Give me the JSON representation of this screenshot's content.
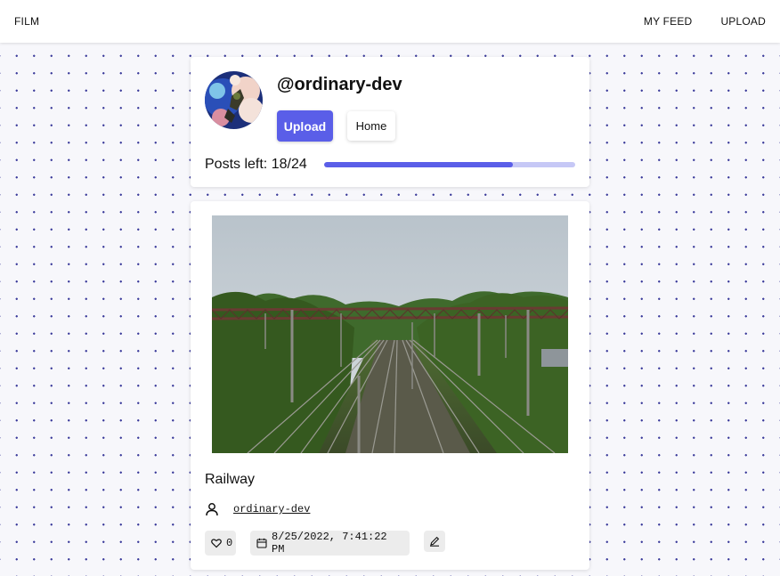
{
  "nav": {
    "brand": "FILM",
    "my_feed": "MY FEED",
    "upload": "UPLOAD"
  },
  "profile": {
    "username": "@ordinary-dev",
    "upload_button": "Upload",
    "home_button": "Home",
    "posts_left_text": "Posts left: 18/24",
    "posts_used": 18,
    "posts_total": 24
  },
  "post": {
    "title": "Railway",
    "author": "ordinary-dev",
    "likes": "0",
    "date": "8/25/2022, 7:41:22 PM"
  },
  "icons": {
    "user": "user-icon",
    "like": "heart-icon",
    "date": "calendar-icon",
    "edit": "pencil-icon"
  },
  "colors": {
    "accent": "#5a5ee8",
    "accent_light": "#c6c8f6",
    "chip_bg": "#ececec"
  }
}
